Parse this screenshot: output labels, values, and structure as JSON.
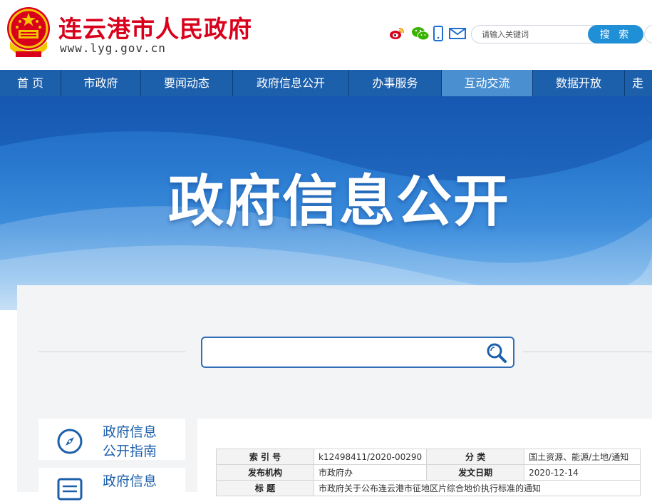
{
  "header": {
    "title": "连云港市人民政府",
    "url": "www.lyg.gov.cn",
    "social": [
      "weibo-icon",
      "wechat-icon",
      "mobile-icon",
      "mail-icon"
    ],
    "search": {
      "placeholder": "请输入关键词",
      "button_label": "搜 索"
    }
  },
  "nav": {
    "items": [
      {
        "label": "首  页"
      },
      {
        "label": "市政府"
      },
      {
        "label": "要闻动态"
      },
      {
        "label": "政府信息公开"
      },
      {
        "label": "办事服务"
      },
      {
        "label": "互动交流"
      },
      {
        "label": "数据开放"
      },
      {
        "label": "走"
      }
    ],
    "active_index": 5
  },
  "banner": {
    "title": "政府信息公开"
  },
  "main_search": {
    "placeholder": ""
  },
  "sidebar": {
    "cards": [
      {
        "line1": "政府信息",
        "line2": "公开指南",
        "icon": "compass-icon"
      },
      {
        "line1": "政府信息",
        "line2": "",
        "icon": "document-icon"
      }
    ]
  },
  "doc_meta": {
    "rows": [
      {
        "k1": "索 引 号",
        "v1": "k12498411/2020-00290",
        "k2": "分  类",
        "v2": "国土资源、能源/土地/通知"
      },
      {
        "k1": "发布机构",
        "v1": "市政府办",
        "k2": "发文日期",
        "v2": "2020-12-14"
      },
      {
        "k1": "标  题",
        "v1": "市政府关于公布连云港市征地区片综合地价执行标准的通知"
      }
    ]
  },
  "colors": {
    "brand_red": "#d9001b",
    "nav_blue": "#1c5faa",
    "nav_active": "#4a8fd0",
    "button_blue": "#1f8fd6"
  }
}
